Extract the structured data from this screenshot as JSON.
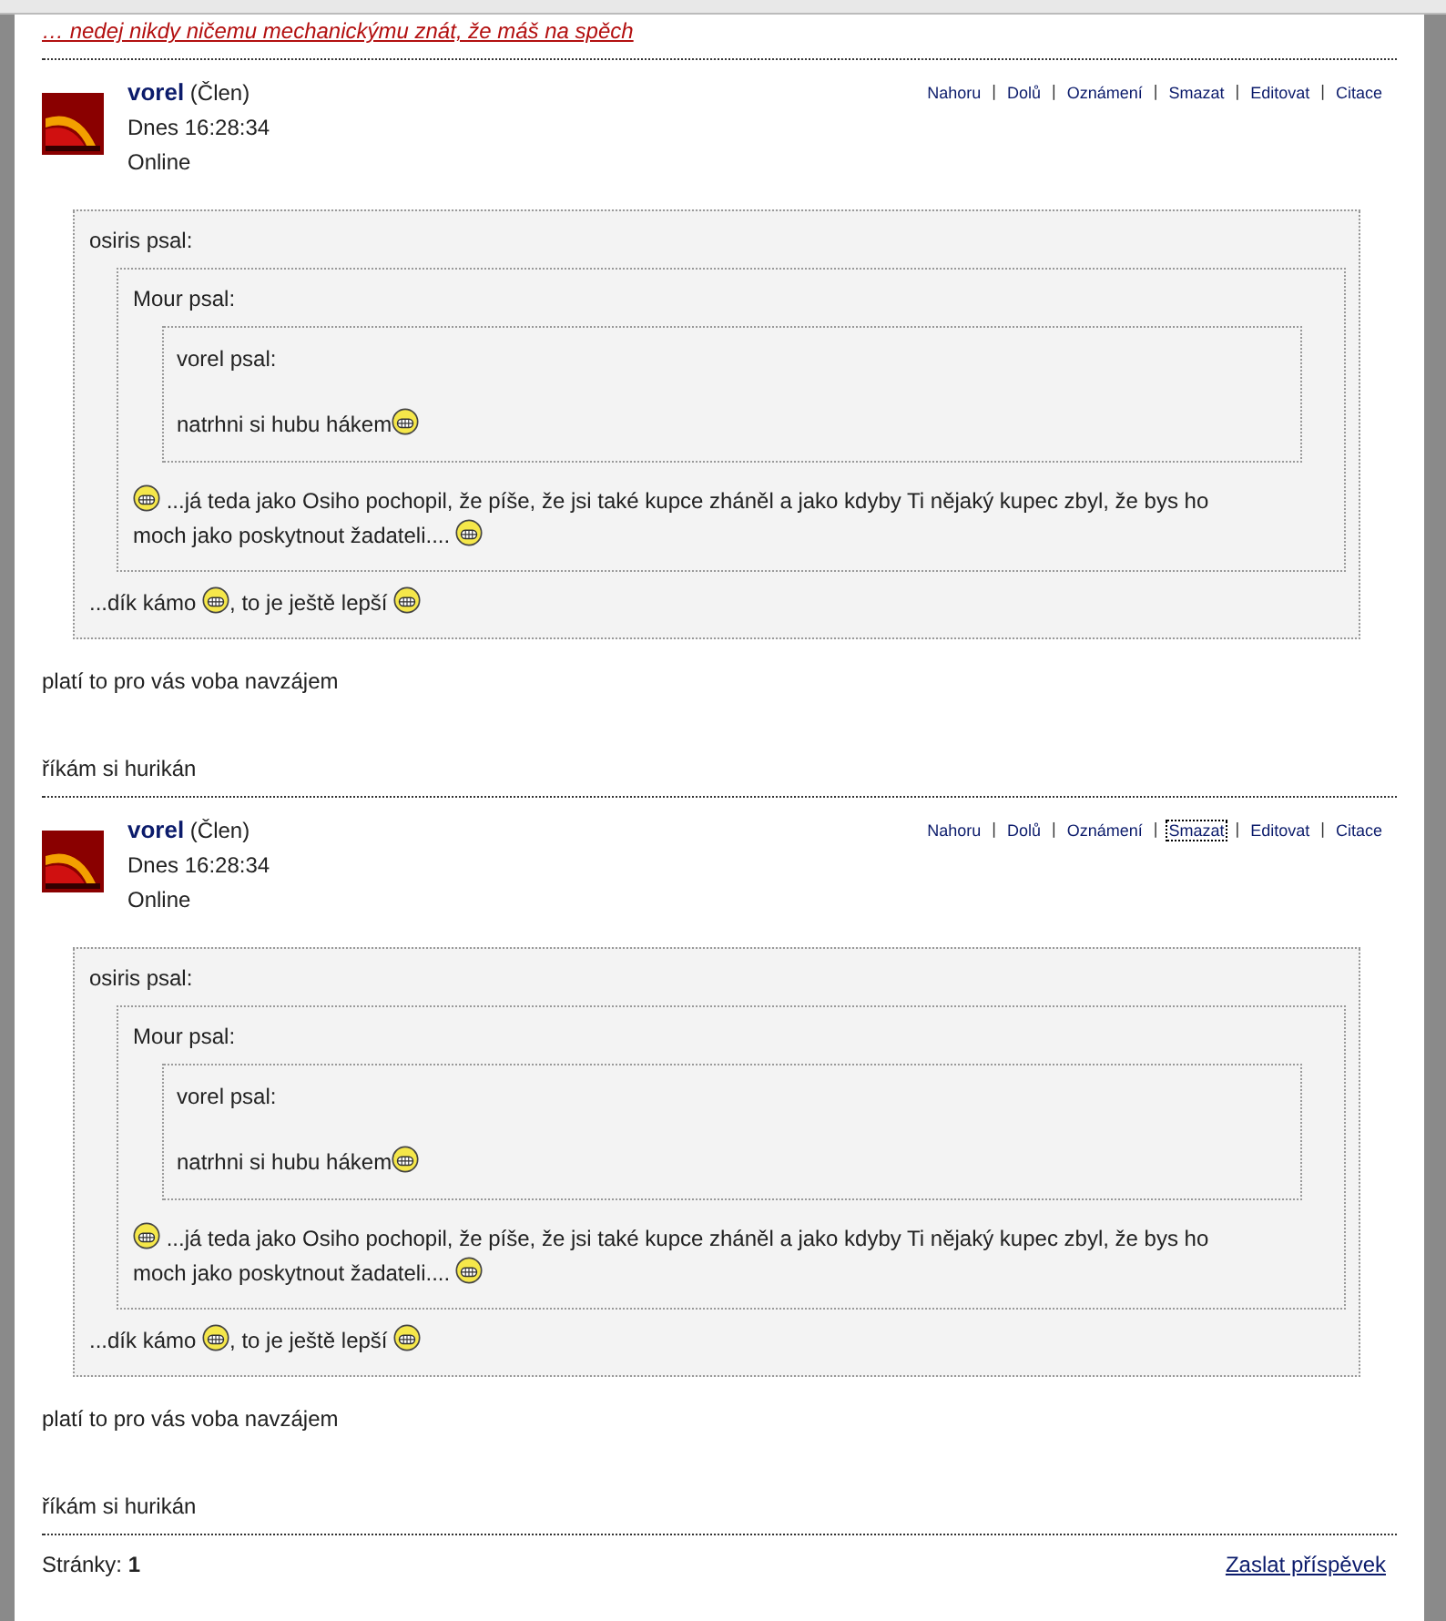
{
  "previous_signature": "… nedej nikdy ničemu mechanickýmu znát, že máš na spěch",
  "posts": [
    {
      "author": "vorel",
      "role": "(Člen)",
      "date": "Dnes 16:28:34",
      "status": "Online",
      "separator": "|",
      "actions": [
        {
          "label": "Nahoru",
          "focused": false
        },
        {
          "label": "Dolů",
          "focused": false
        },
        {
          "label": "Oznámení",
          "focused": false
        },
        {
          "label": "Smazat",
          "focused": false
        },
        {
          "label": "Editovat",
          "focused": false
        },
        {
          "label": "Citace",
          "focused": false
        }
      ],
      "quote": {
        "author": "osiris psal:",
        "body": [
          {
            "kind": "text",
            "text": "...dík kámo "
          },
          {
            "kind": "smiley"
          },
          {
            "kind": "text",
            "text": ", to je ještě lepší "
          },
          {
            "kind": "smiley"
          }
        ],
        "quote": {
          "author": "Mour psal:",
          "body": [
            {
              "kind": "smiley"
            },
            {
              "kind": "text",
              "text": " ...já teda jako Osiho pochopil, že píše, že jsi také kupce zháněl a jako kdyby Ti nějaký kupec zbyl, že bys ho"
            },
            {
              "kind": "break"
            },
            {
              "kind": "text",
              "text": "moch jako poskytnout žadateli.... "
            },
            {
              "kind": "smiley"
            }
          ],
          "quote": {
            "author": "vorel psal:",
            "body": [
              {
                "kind": "text",
                "text": "natrhni si hubu hákem"
              },
              {
                "kind": "smiley"
              }
            ]
          }
        }
      },
      "text": "platí to pro vás voba navzájem",
      "signature": "říkám si hurikán"
    },
    {
      "author": "vorel",
      "role": "(Člen)",
      "date": "Dnes 16:28:34",
      "status": "Online",
      "separator": "|",
      "actions": [
        {
          "label": "Nahoru",
          "focused": false
        },
        {
          "label": "Dolů",
          "focused": false
        },
        {
          "label": "Oznámení",
          "focused": false
        },
        {
          "label": "Smazat",
          "focused": true
        },
        {
          "label": "Editovat",
          "focused": false
        },
        {
          "label": "Citace",
          "focused": false
        }
      ],
      "quote": {
        "author": "osiris psal:",
        "body": [
          {
            "kind": "text",
            "text": "...dík kámo "
          },
          {
            "kind": "smiley"
          },
          {
            "kind": "text",
            "text": ", to je ještě lepší "
          },
          {
            "kind": "smiley"
          }
        ],
        "quote": {
          "author": "Mour psal:",
          "body": [
            {
              "kind": "smiley"
            },
            {
              "kind": "text",
              "text": " ...já teda jako Osiho pochopil, že píše, že jsi také kupce zháněl a jako kdyby Ti nějaký kupec zbyl, že bys ho"
            },
            {
              "kind": "break"
            },
            {
              "kind": "text",
              "text": "moch jako poskytnout žadateli.... "
            },
            {
              "kind": "smiley"
            }
          ],
          "quote": {
            "author": "vorel psal:",
            "body": [
              {
                "kind": "text",
                "text": "natrhni si hubu hákem"
              },
              {
                "kind": "smiley"
              }
            ]
          }
        }
      },
      "text": "platí to pro vás voba navzájem",
      "signature": "říkám si hurikán"
    }
  ],
  "footer": {
    "pages": "Stránky: **1**",
    "send_link": "Zaslat příspěvek"
  }
}
